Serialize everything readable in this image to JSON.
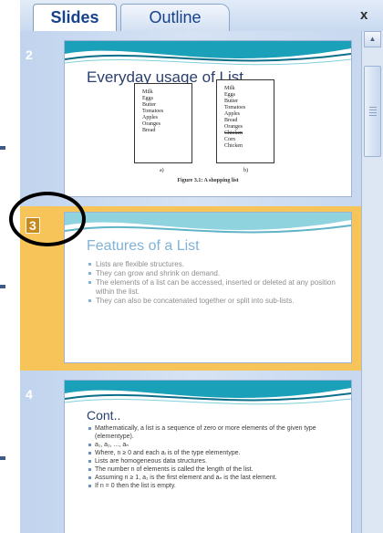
{
  "tabs": [
    {
      "label": "Slides",
      "active": true
    },
    {
      "label": "Outline",
      "active": false
    }
  ],
  "close_label": "x",
  "slides": [
    {
      "number": "2",
      "title": "Everyday usage of List",
      "lists": {
        "a": [
          "Milk",
          "Eggs",
          "Butter",
          "Tomatoes",
          "Apples",
          "Oranges",
          "Bread"
        ],
        "b": [
          "Milk",
          "Eggs",
          "Butter",
          "Tomatoes",
          "Apples",
          "Bread",
          "Oranges",
          "Chicken",
          "Corn",
          "Chicken"
        ]
      },
      "labels": [
        "a)",
        "b)"
      ],
      "caption": "Figure 3.1: A shopping list"
    },
    {
      "number": "3",
      "selected": true,
      "title": "Features of a List",
      "bullets": [
        "Lists are flexible structures.",
        "They can grow and shrink on demand.",
        "The elements of a list can be accessed, inserted or deleted at any position within the list.",
        "They can also be concatenated together or split into sub-lists."
      ]
    },
    {
      "number": "4",
      "title": "Cont..",
      "bullets": [
        "Mathematically, a list is a sequence of zero or more elements of the given type (elementype).",
        "a₁, a₂, ..., aₙ",
        "Where, n ≥ 0 and each aᵢ is of the type elementype.",
        "Lists are homogeneous data structures.",
        "The number n of elements is called the length of the list.",
        "Assuming n ≥ 1, a₁ is the first element and aₙ is the last element.",
        "If n = 0 then the list is empty."
      ]
    }
  ],
  "colors": {
    "selection": "#f7c45a",
    "panel": "#c1d4ee",
    "tab_text": "#15428b"
  }
}
